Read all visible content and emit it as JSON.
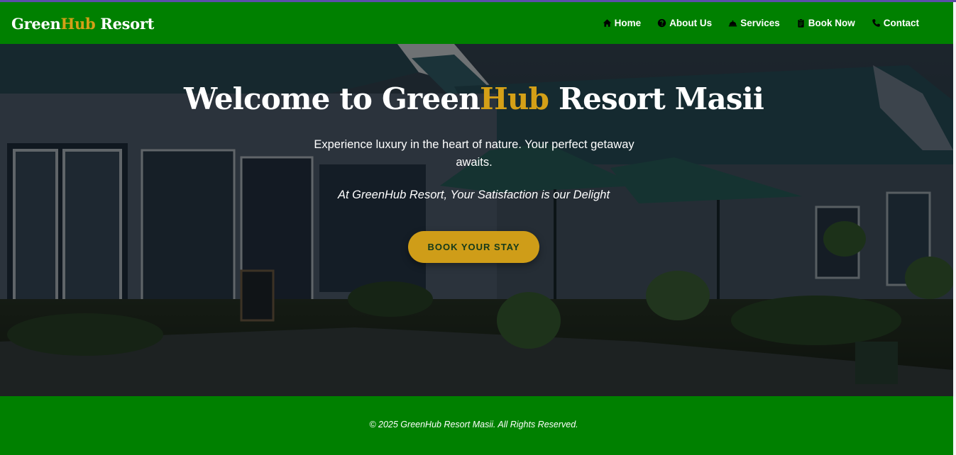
{
  "brand": {
    "part1": "Green",
    "part2": "Hub",
    "part3": " Resort"
  },
  "nav": {
    "items": [
      {
        "label": "Home",
        "icon": "home-icon"
      },
      {
        "label": "About Us",
        "icon": "question-circle-icon"
      },
      {
        "label": "Services",
        "icon": "bell-icon"
      },
      {
        "label": "Book Now",
        "icon": "clipboard-icon"
      },
      {
        "label": "Contact",
        "icon": "phone-icon"
      }
    ]
  },
  "hero": {
    "title_part1": "Welcome to Green",
    "title_part2": "Hub",
    "title_part3": " Resort Masii",
    "subtitle": "Experience luxury in the heart of nature. Your perfect getaway awaits.",
    "tagline": "At GreenHub Resort, Your Satisfaction is our Delight",
    "cta_label": "BOOK YOUR STAY"
  },
  "footer": {
    "copyright": "© 2025 GreenHub Resort Masii. All Rights Reserved."
  },
  "colors": {
    "primary_green": "#008000",
    "accent_gold": "#d4a017",
    "button_gold": "#cf9d18"
  }
}
